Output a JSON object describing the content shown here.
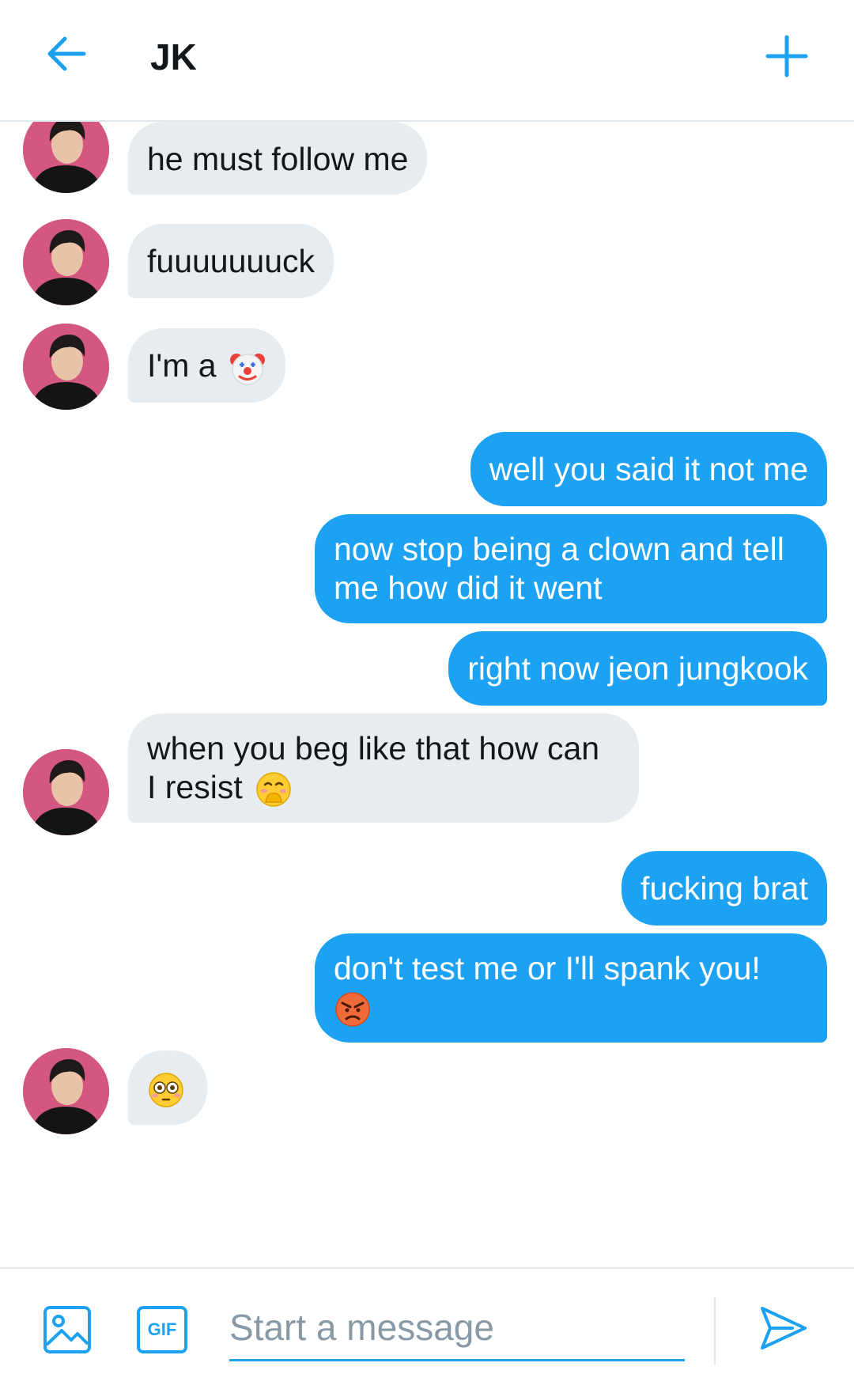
{
  "header": {
    "title": "JK",
    "back_icon": "arrow-left-icon",
    "new_icon": "plus-icon"
  },
  "messages": [
    {
      "from": "them",
      "text": "he must follow me"
    },
    {
      "from": "them",
      "text": "fuuuuuuuck"
    },
    {
      "from": "them",
      "text": "I'm a",
      "emoji": "clown-face"
    },
    {
      "from": "me",
      "text": "well you said it not me"
    },
    {
      "from": "me",
      "line1": "now stop being a clown and tell",
      "line2": "me how did it went"
    },
    {
      "from": "me",
      "text": "right now jeon jungkook"
    },
    {
      "from": "them",
      "line1": "when you beg like that how can",
      "line2": "I resist",
      "emoji": "hand-over-mouth-face"
    },
    {
      "from": "me",
      "text": "fucking brat"
    },
    {
      "from": "me",
      "line1": "don't test me or I'll spank you!",
      "emoji": "angry-face"
    },
    {
      "from": "them",
      "emoji": "flushed-face"
    }
  ],
  "composer": {
    "placeholder": "Start a message",
    "gif_label": "GIF",
    "image_icon": "image-icon",
    "send_icon": "send-icon"
  },
  "colors": {
    "accent": "#1da1f2",
    "incoming_bubble": "#e6ecf0",
    "outgoing_bubble": "#1da1f2",
    "text": "#14171a",
    "placeholder": "#8899a6"
  }
}
